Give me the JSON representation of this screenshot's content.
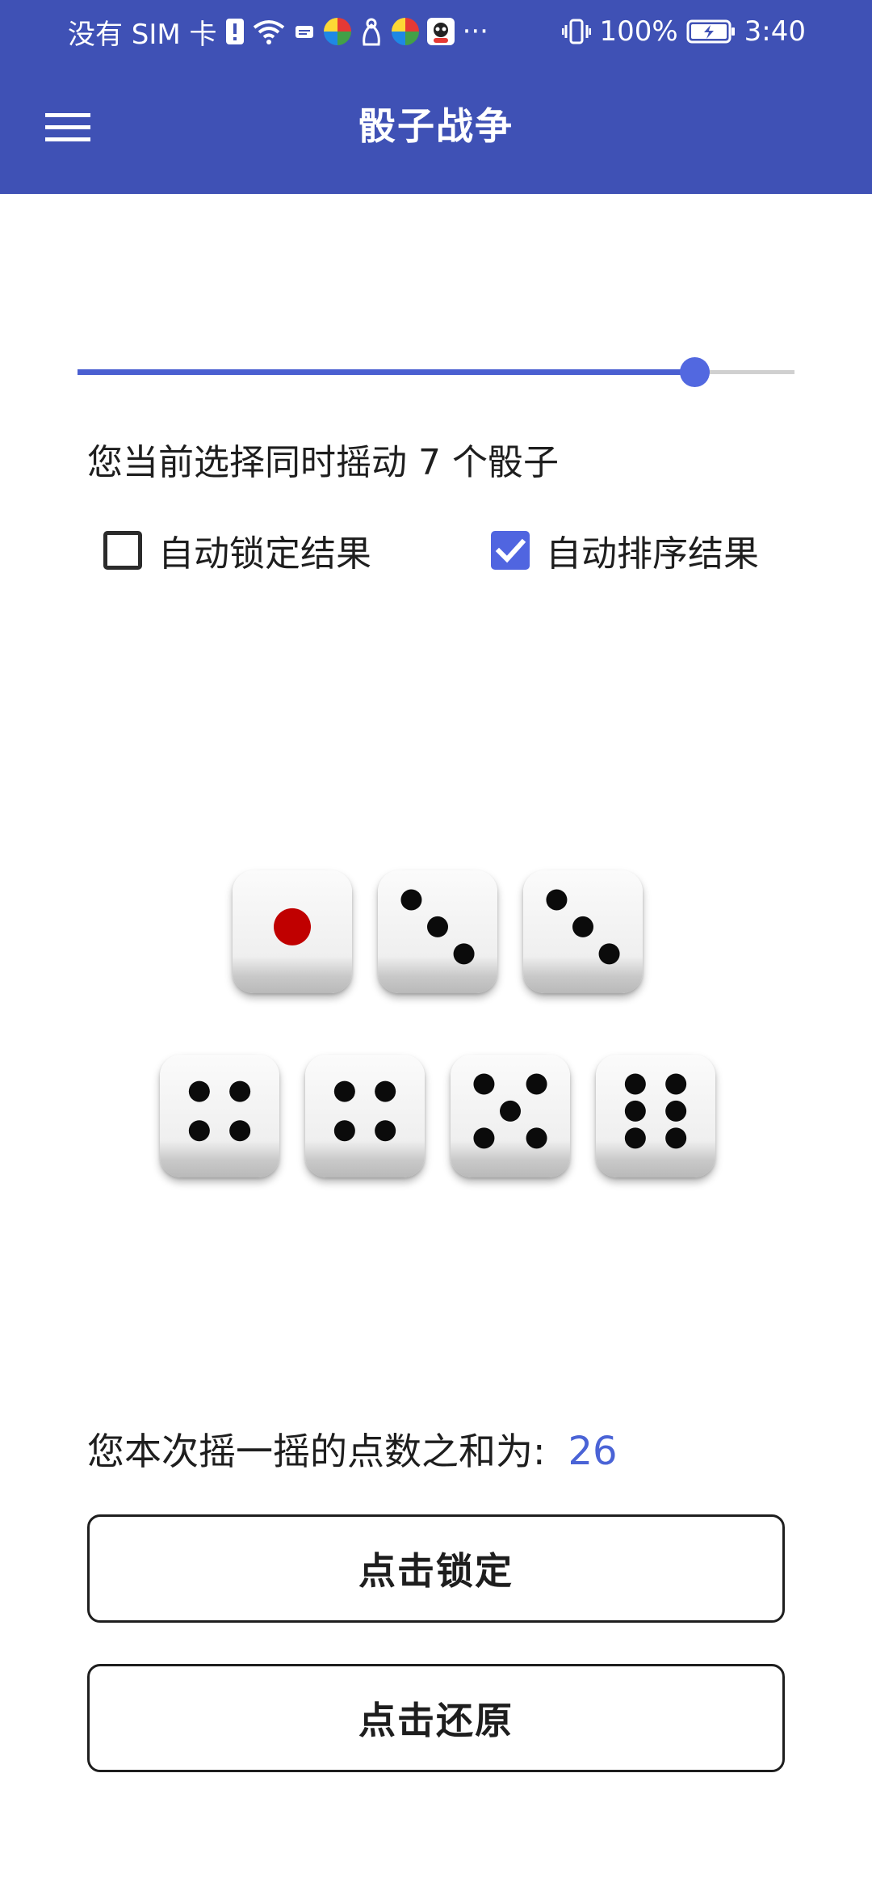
{
  "status_bar": {
    "carrier": "没有 SIM 卡",
    "more": "···",
    "battery": "100%",
    "time": "3:40"
  },
  "app_bar": {
    "title": "骰子战争",
    "menu_icon": "hamburger-menu-icon"
  },
  "slider": {
    "fraction": 0.86,
    "accent": "#4a5fd1"
  },
  "dice_count_text": "您当前选择同时摇动 7 个骰子",
  "options": {
    "auto_lock": {
      "label": "自动锁定结果",
      "checked": false
    },
    "auto_sort": {
      "label": "自动排序结果",
      "checked": true
    }
  },
  "dice": [
    1,
    3,
    3,
    4,
    4,
    5,
    6
  ],
  "sum": {
    "label": "您本次摇一摇的点数之和为:",
    "value": "26"
  },
  "buttons": {
    "lock": "点击锁定",
    "restore": "点击还原"
  },
  "colors": {
    "primary": "#3f51b5",
    "accent": "#5065e0",
    "sum_value": "#4a63d6",
    "one_pip": "#c00000"
  }
}
